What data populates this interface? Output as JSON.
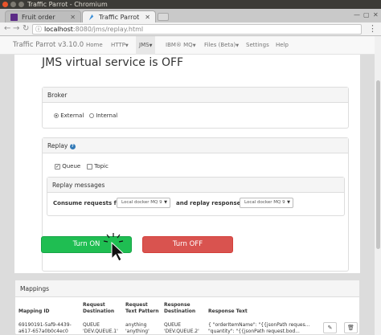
{
  "window": {
    "title": "Traffic Parrot - Chromium"
  },
  "tabs": [
    {
      "label": "Fruit order system",
      "active": false
    },
    {
      "label": "Traffic Parrot",
      "active": true
    }
  ],
  "address": {
    "host": "localhost",
    "path": ":8080/jms/replay.html"
  },
  "navbar": {
    "brand": "Traffic Parrot v3.10.0",
    "items": {
      "home": "Home",
      "http": "HTTP",
      "jms": "JMS",
      "ibmmq": "IBM® MQ",
      "files": "Files (Beta)",
      "settings": "Settings",
      "help": "Help"
    }
  },
  "main": {
    "title": "JMS virtual service is OFF",
    "broker": {
      "heading": "Broker",
      "options": [
        "External",
        "Internal"
      ],
      "selected": "External"
    },
    "replay": {
      "heading": "Replay",
      "options": {
        "queue": "Queue",
        "topic": "Topic"
      },
      "queue_checked": true,
      "topic_checked": false,
      "messages": {
        "heading": "Replay messages",
        "consume_label": "Consume requests from",
        "consume_value": "Local docker MQ 9",
        "reply_label": "and replay responses to",
        "reply_value": "Local docker MQ 9"
      }
    },
    "turn_on_label": "Turn ON",
    "turn_off_label": "Turn OFF"
  },
  "colors": {
    "on": "#1fbe52",
    "off": "#d9534f",
    "info": "#337ab7"
  },
  "mappings": {
    "heading": "Mappings",
    "headers": {
      "id": "Mapping ID",
      "req_dest_1": "Request",
      "req_dest_2": "Destination",
      "req_text_1": "Request",
      "req_text_2": "Text Pattern",
      "resp_dest_1": "Response",
      "resp_dest_2": "Destination",
      "resp_text": "Response Text"
    },
    "row": {
      "id_1": "69190191-5af9-4439-",
      "id_2": "a617-657a0b0c4ec0",
      "req_dest_1": "QUEUE",
      "req_dest_2": "'DEV.QUEUE.1'",
      "req_text_1": "anything",
      "req_text_2": "'anything'",
      "resp_dest_1": "QUEUE",
      "resp_dest_2": "'DEV.QUEUE.2'",
      "resp_text_1": "{ \"orderItemName\": \"{{jsonPath reques...",
      "resp_text_2": "\"quantity\": \"{{jsonPath request.bod..."
    }
  }
}
